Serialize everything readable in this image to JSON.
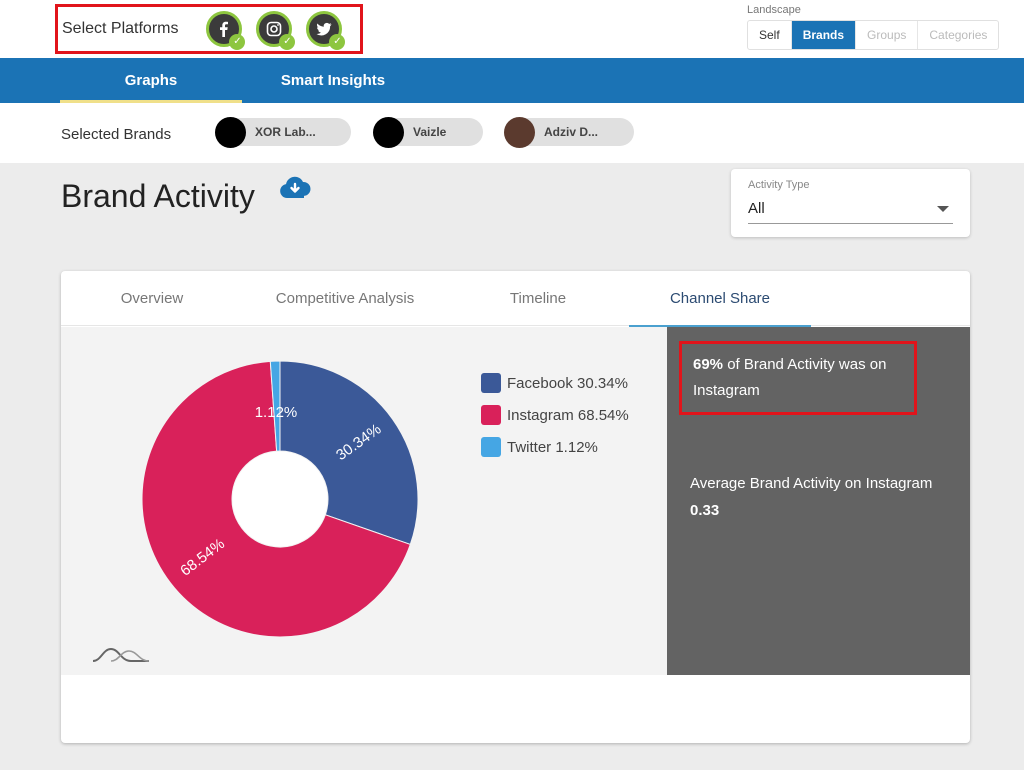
{
  "header": {
    "platforms_label": "Select Platforms",
    "platforms": [
      {
        "name": "Facebook",
        "icon": "facebook-icon",
        "selected": true
      },
      {
        "name": "Instagram",
        "icon": "instagram-icon",
        "selected": true
      },
      {
        "name": "Twitter",
        "icon": "twitter-icon",
        "selected": true
      }
    ],
    "landscape": {
      "label": "Landscape",
      "options": [
        "Self",
        "Brands",
        "Groups",
        "Categories"
      ],
      "selected": "Brands"
    }
  },
  "nav": {
    "tabs": [
      {
        "label": "Graphs",
        "active": true
      },
      {
        "label": "Smart Insights",
        "active": false
      }
    ]
  },
  "brands": {
    "label": "Selected Brands",
    "items": [
      {
        "name": "XOR Lab...",
        "color": "#000000"
      },
      {
        "name": "Vaizle",
        "color": "#000000"
      },
      {
        "name": "Adziv D...",
        "color": "#5b3a2e"
      }
    ]
  },
  "page": {
    "title": "Brand Activity",
    "download_icon": "cloud-download-icon",
    "activity_type": {
      "label": "Activity Type",
      "value": "All"
    }
  },
  "card": {
    "tabs": [
      {
        "label": "Overview",
        "active": false
      },
      {
        "label": "Competitive Analysis",
        "active": false
      },
      {
        "label": "Timeline",
        "active": false
      },
      {
        "label": "Channel Share",
        "active": true
      }
    ],
    "insight": {
      "highlight": "69%",
      "text": " of Brand Activity was on Instagram",
      "avg_label": "Average Brand Activity on Instagram",
      "avg_value": "0.33"
    }
  },
  "colors": {
    "brand_blue": "#1b73b5",
    "highlight_red": "#e1141b",
    "check_green": "#8dc63f"
  },
  "chart_data": {
    "type": "pie",
    "subtype": "donut",
    "title": "",
    "legend_position": "right",
    "series": [
      {
        "name": "Facebook",
        "value": 30.34,
        "label": "30.34%",
        "legend": "Facebook 30.34%",
        "color": "#3b5998"
      },
      {
        "name": "Instagram",
        "value": 68.54,
        "label": "68.54%",
        "legend": "Instagram 68.54%",
        "color": "#d9215a"
      },
      {
        "name": "Twitter",
        "value": 1.12,
        "label": "1.12%",
        "legend": "Twitter 1.12%",
        "color": "#45a6e4"
      }
    ]
  }
}
